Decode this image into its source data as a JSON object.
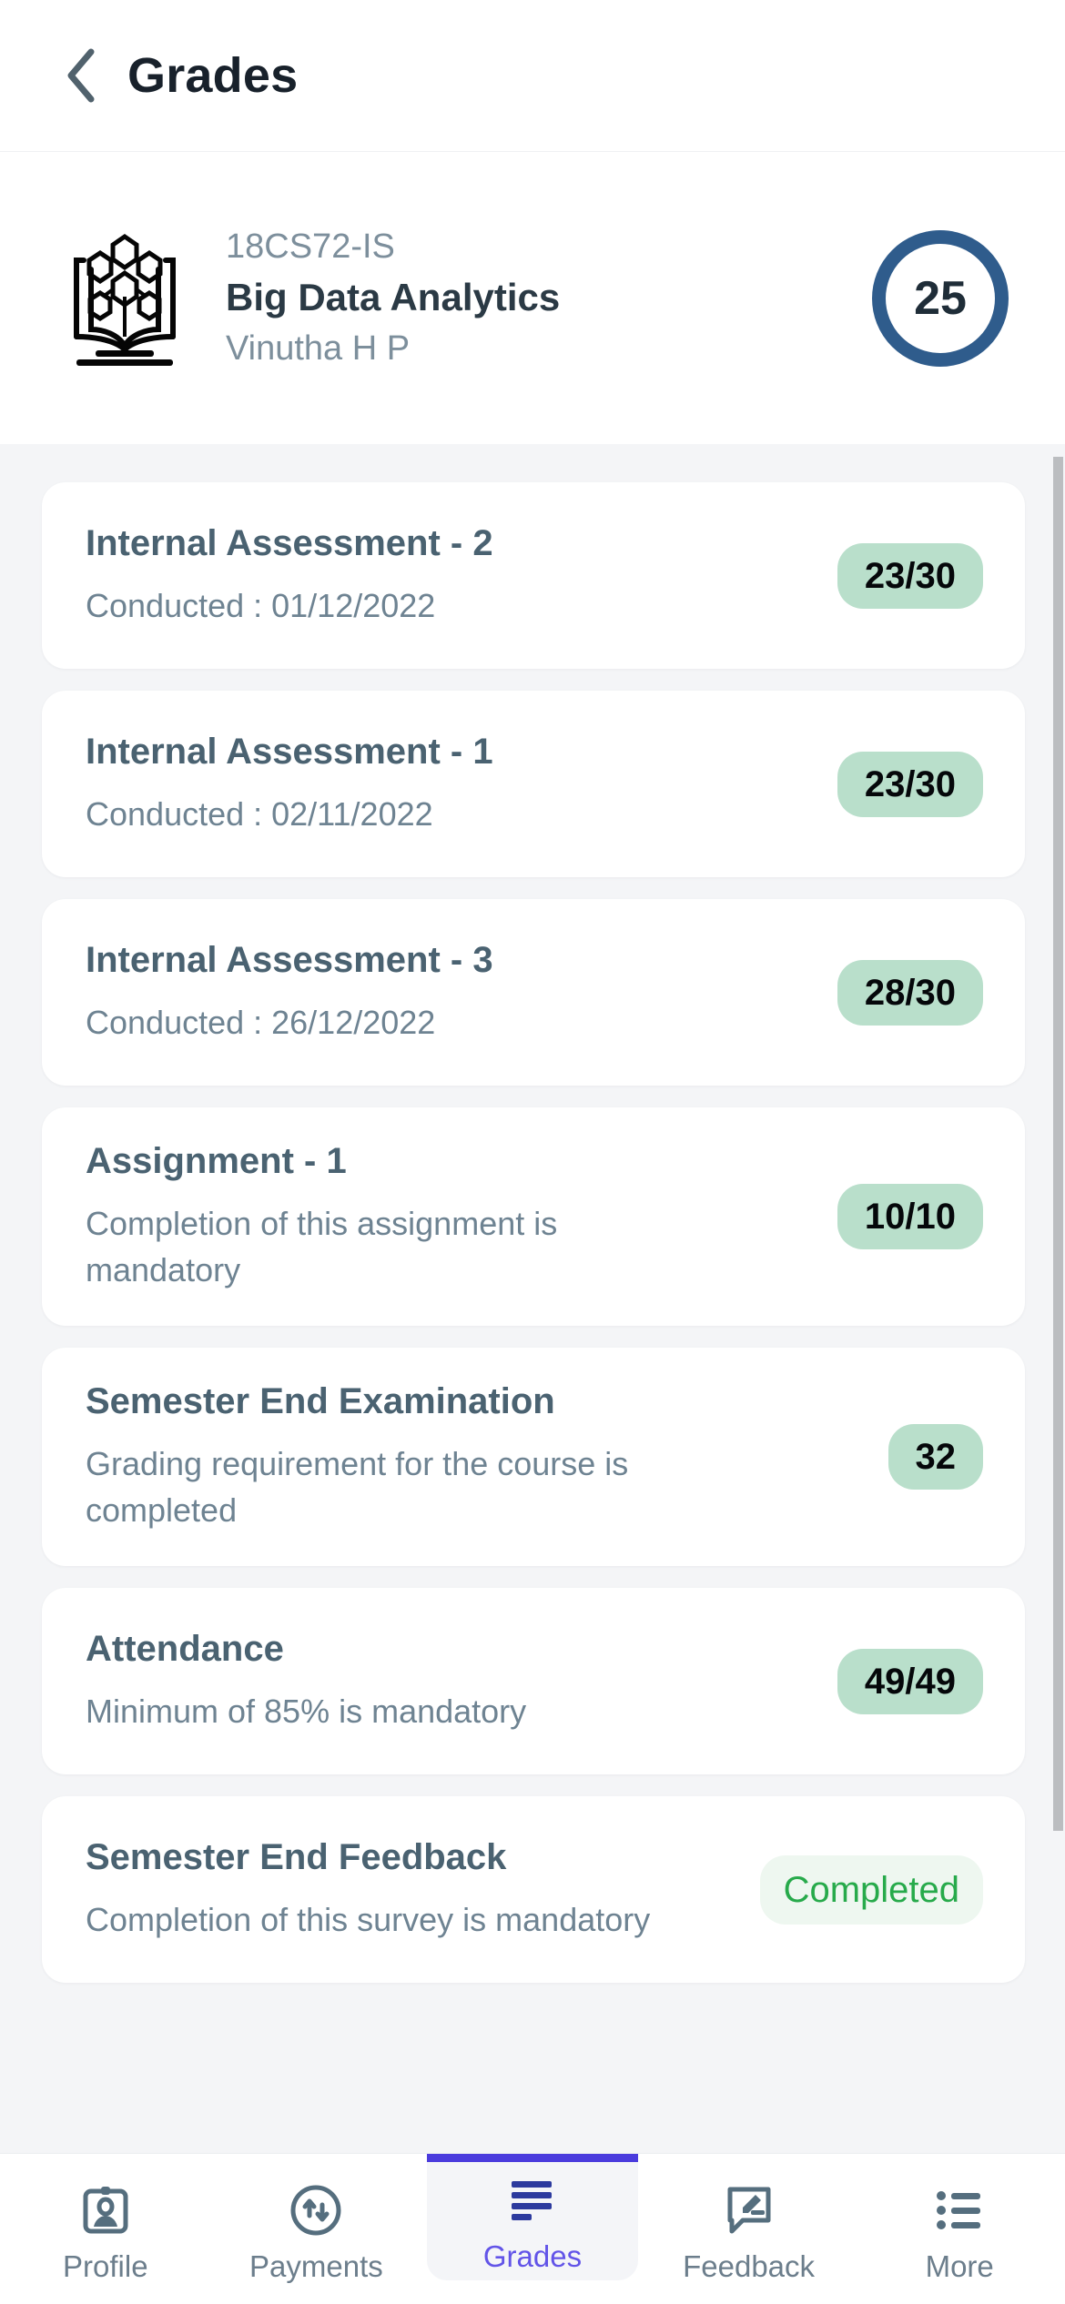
{
  "appbar": {
    "back_icon": "chevron-left-icon",
    "title": "Grades"
  },
  "course": {
    "icon": "book-data-analytics-icon",
    "code": "18CS72-IS",
    "name": "Big Data Analytics",
    "faculty": "Vinutha H P",
    "score": "25",
    "score_ring_color": "#2f5c8c"
  },
  "colors": {
    "page_background": "#f4f5f7",
    "card_background": "#ffffff",
    "badge_green": "#b9dfcb",
    "status_green_bg": "#eef7f0",
    "status_green_text": "#27aa4b",
    "title_text": "#4a6271",
    "sub_text": "#6e8392",
    "active_tab": "#6254e8",
    "active_tab_bar": "#4a3bdd",
    "nav_icon": "#556e7e",
    "grades_icon": "#2c3a9e"
  },
  "items": [
    {
      "title": "Internal Assessment - 2",
      "subtitle": "Conducted : 01/12/2022",
      "badge": "23/30",
      "badge_type": "score"
    },
    {
      "title": "Internal Assessment - 1",
      "subtitle": "Conducted : 02/11/2022",
      "badge": "23/30",
      "badge_type": "score"
    },
    {
      "title": "Internal Assessment - 3",
      "subtitle": "Conducted : 26/12/2022",
      "badge": "28/30",
      "badge_type": "score"
    },
    {
      "title": "Assignment - 1",
      "subtitle": "Completion of this assignment is mandatory",
      "badge": "10/10",
      "badge_type": "score"
    },
    {
      "title": "Semester End Examination",
      "subtitle": "Grading requirement for the course is completed",
      "badge": "32",
      "badge_type": "score"
    },
    {
      "title": "Attendance",
      "subtitle": "Minimum of 85% is mandatory",
      "badge": "49/49",
      "badge_type": "score"
    },
    {
      "title": "Semester End Feedback",
      "subtitle": "Completion of this survey is mandatory",
      "badge": "Completed",
      "badge_type": "status"
    }
  ],
  "bottom_nav": {
    "items": [
      {
        "label": "Profile",
        "icon": "id-badge-icon",
        "active": false
      },
      {
        "label": "Payments",
        "icon": "transfer-circle-icon",
        "active": false
      },
      {
        "label": "Grades",
        "icon": "grades-lines-icon",
        "active": true
      },
      {
        "label": "Feedback",
        "icon": "comment-edit-icon",
        "active": false
      },
      {
        "label": "More",
        "icon": "list-bullets-icon",
        "active": false
      }
    ]
  }
}
